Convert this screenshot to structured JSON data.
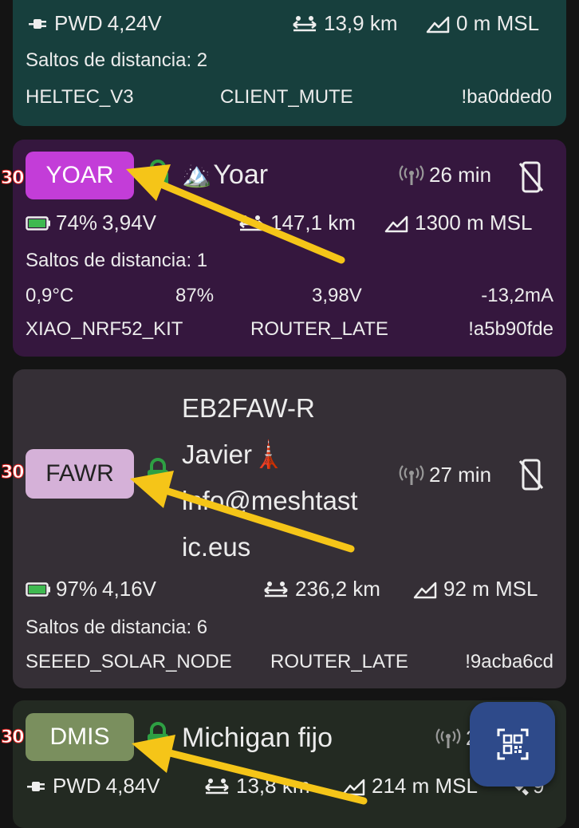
{
  "colors": {
    "card1_bg": "#173f3d",
    "card2_bg": "#35173e",
    "card3_bg": "#352f36",
    "card4_bg": "#232a22",
    "chip_yoar": "#c33dd8",
    "chip_fawr": "#d5b1d8",
    "chip_dmis": "#7a8f5e",
    "arrow": "#f5c518",
    "fab": "#2e4a8a"
  },
  "nodes": [
    {
      "power": "PWD",
      "voltage": "4,24V",
      "distance": "13,9 km",
      "altitude": "0 m MSL",
      "hops": "Saltos de distancia: 2",
      "hw_model": "HELTEC_V3",
      "role": "CLIENT_MUTE",
      "node_id": "!ba0dded0"
    },
    {
      "badge": "30",
      "short_name": "YOAR",
      "emoji": "🏔️",
      "long_name": "Yoar",
      "last_heard": "26 min",
      "battery": "74%",
      "voltage": "3,94V",
      "distance": "147,1 km",
      "altitude": "1300 m MSL",
      "hops": "Saltos de distancia: 1",
      "telemetry": [
        "0,9°C",
        "87%",
        "3,98V",
        "-13,2mA"
      ],
      "hw_model": "XIAO_NRF52_KIT",
      "role": "ROUTER_LATE",
      "node_id": "!a5b90fde"
    },
    {
      "badge": "30",
      "short_name": "FAWR",
      "long_name_lines": [
        "EB2FAW-R",
        "Javier🗼",
        "info@meshtast",
        "ic.eus"
      ],
      "last_heard": "27 min",
      "battery": "97%",
      "voltage": "4,16V",
      "distance": "236,2 km",
      "altitude": "92 m MSL",
      "hops": "Saltos de distancia: 6",
      "hw_model": "SEEED_SOLAR_NODE",
      "role": "ROUTER_LATE",
      "node_id": "!9acba6cd"
    },
    {
      "badge": "30",
      "short_name": "DMIS",
      "long_name": "Michigan fijo",
      "last_heard": "2",
      "power": "PWD",
      "voltage": "4,84V",
      "distance": "13,8 km",
      "altitude": "214 m MSL",
      "sats": "9"
    }
  ]
}
